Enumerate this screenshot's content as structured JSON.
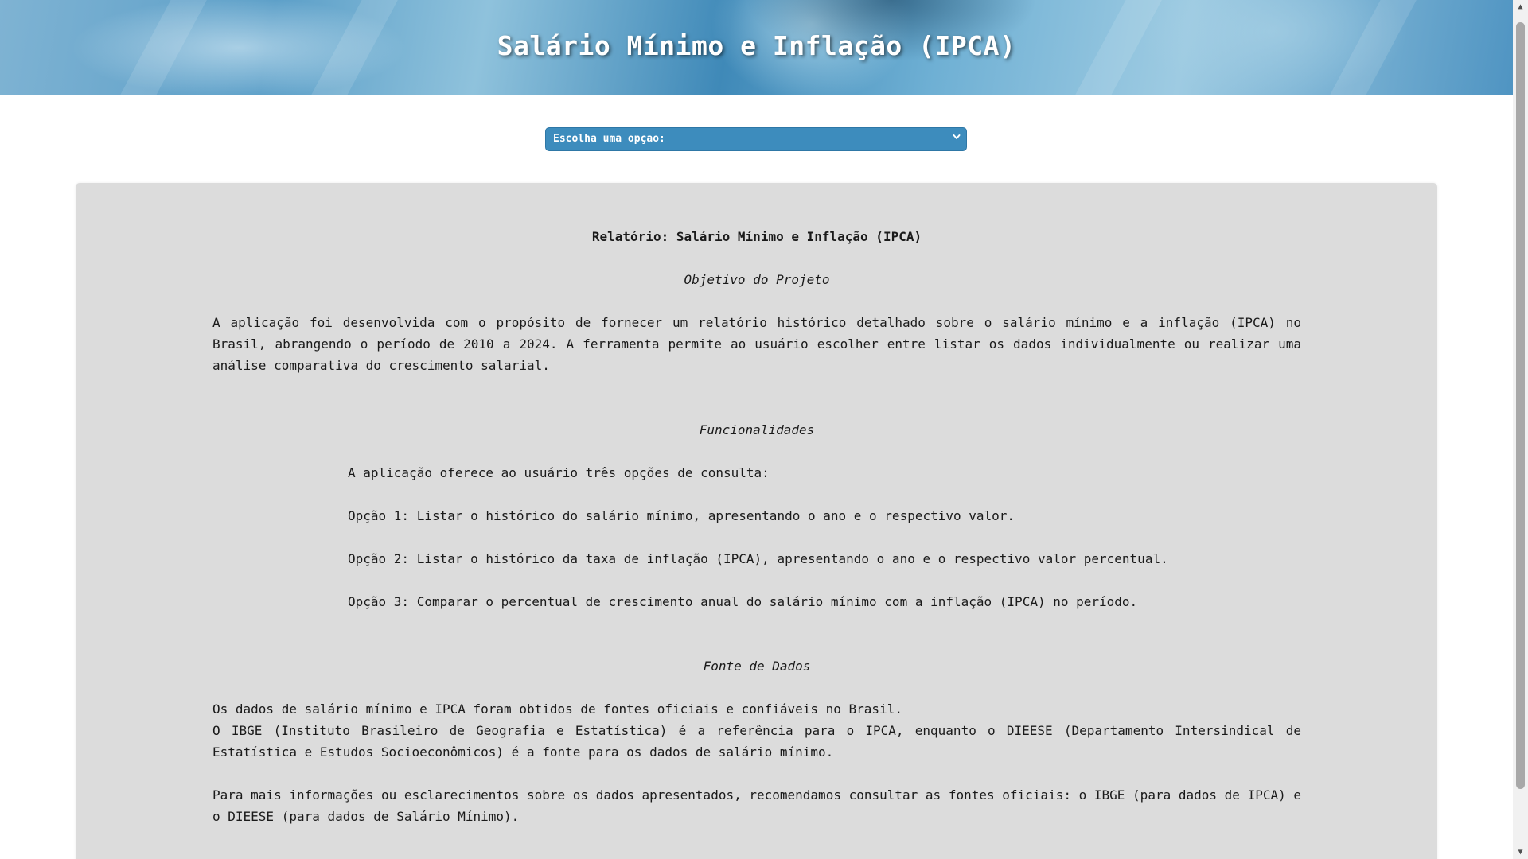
{
  "header": {
    "title": "Salário Mínimo e Inflação (IPCA)"
  },
  "selector": {
    "selected": "Escolha uma opção:",
    "icon": "chevron-down-icon"
  },
  "report": {
    "title": "Relatório: Salário Mínimo e Inflação (IPCA)",
    "objective": {
      "heading": "Objetivo do Projeto",
      "text": "A aplicação foi desenvolvida com o propósito de fornecer um relatório histórico detalhado sobre o salário mínimo e a inflação (IPCA) no Brasil, abrangendo o período de 2010 a 2024. A ferramenta permite ao usuário escolher entre listar os dados individualmente ou realizar uma análise comparativa do crescimento salarial."
    },
    "features": {
      "heading": "Funcionalidades",
      "intro": "A aplicação oferece ao usuário três opções de consulta:",
      "options": [
        "Opção 1: Listar o histórico do salário mínimo, apresentando o ano e o respectivo valor.",
        "Opção 2: Listar o histórico da taxa de inflação (IPCA), apresentando o ano e o respectivo valor percentual.",
        "Opção 3: Comparar o percentual de crescimento anual do salário mínimo com a inflação (IPCA) no período."
      ]
    },
    "sources": {
      "heading": "Fonte de Dados",
      "line1": "Os dados de salário mínimo e IPCA foram obtidos de fontes oficiais e confiáveis no Brasil.",
      "line2": "O IBGE (Instituto Brasileiro de Geografia e Estatística) é a referência para o IPCA, enquanto o DIEESE (Departamento Intersindical de Estatística e Estudos Socioeconômicos) é a fonte para os dados de salário mínimo.",
      "more_info": "Para mais informações ou esclarecimentos sobre os dados apresentados, recomendamos consultar as fontes oficiais: o IBGE (para dados de IPCA) e o DIEESE (para dados de Salário Mínimo)."
    }
  },
  "colors": {
    "select_bg": "#3d8cbd",
    "report_bg": "#dcdcdc",
    "header_blue": "#5c9fc8"
  }
}
